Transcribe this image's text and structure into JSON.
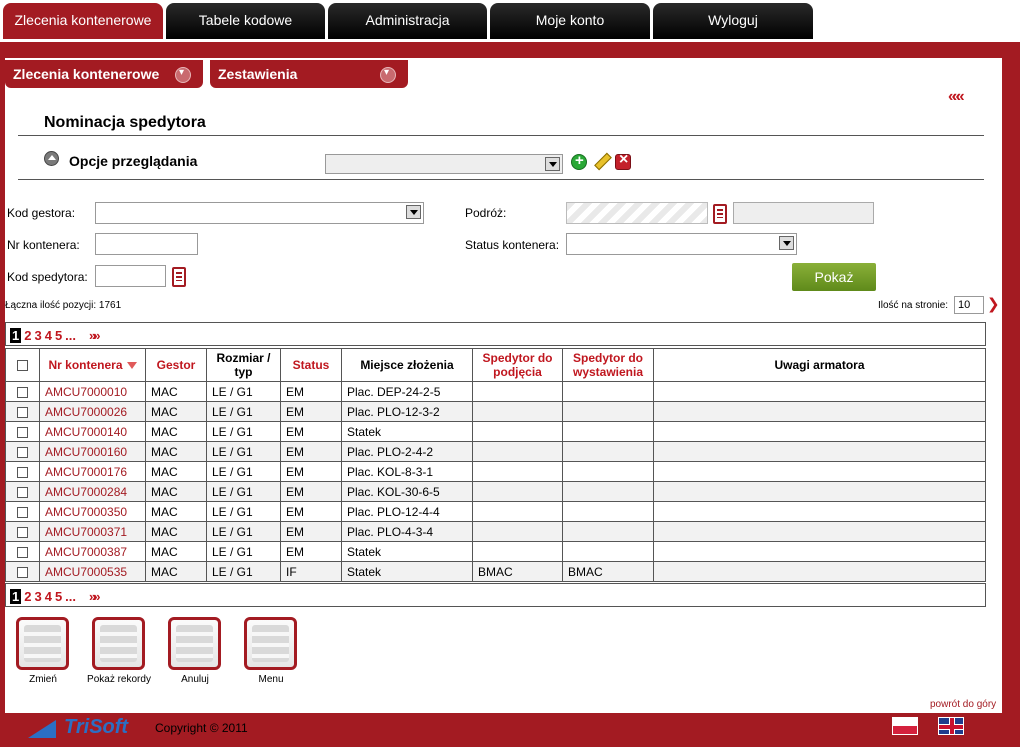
{
  "top_tabs": [
    {
      "label": "Zlecenia kontenerowe",
      "active": true
    },
    {
      "label": "Tabele kodowe",
      "active": false
    },
    {
      "label": "Administracja",
      "active": false
    },
    {
      "label": "Moje konto",
      "active": false
    },
    {
      "label": "Wyloguj",
      "active": false
    }
  ],
  "sub_tabs": [
    {
      "label": "Zlecenia kontenerowe"
    },
    {
      "label": "Zestawienia"
    }
  ],
  "page": {
    "title": "Nominacja spedytora",
    "options_title": "Opcje przeglądania"
  },
  "filters": {
    "kod_gestora_label": "Kod gestora:",
    "nr_kontenera_label": "Nr kontenera:",
    "kod_spedytora_label": "Kod spedytora:",
    "podroz_label": "Podróż:",
    "status_kontenera_label": "Status kontenera:",
    "show_button": "Pokaż"
  },
  "summary": {
    "total_label": "Łączna ilość pozycji: 1761",
    "per_page_label": "Ilość na stronie:",
    "per_page_value": "10"
  },
  "pager": {
    "pages": [
      "1",
      "2",
      "3",
      "4",
      "5",
      "..."
    ],
    "current": "1"
  },
  "table": {
    "headers": [
      {
        "label": "",
        "red": false
      },
      {
        "label": "Nr kontenera",
        "red": true
      },
      {
        "label": "Gestor",
        "red": true
      },
      {
        "label": "Rozmiar / typ",
        "red": false
      },
      {
        "label": "Status",
        "red": true
      },
      {
        "label": "Miejsce złożenia",
        "red": false
      },
      {
        "label": "Spedytor do podjęcia",
        "red": true
      },
      {
        "label": "Spedytor do wystawienia",
        "red": true
      },
      {
        "label": "Uwagi armatora",
        "red": false
      }
    ],
    "rows": [
      [
        "AMCU7000010",
        "MAC",
        "LE / G1",
        "EM",
        "Plac. DEP-24-2-5",
        "",
        "",
        ""
      ],
      [
        "AMCU7000026",
        "MAC",
        "LE / G1",
        "EM",
        "Plac. PLO-12-3-2",
        "",
        "",
        ""
      ],
      [
        "AMCU7000140",
        "MAC",
        "LE / G1",
        "EM",
        "Statek",
        "",
        "",
        ""
      ],
      [
        "AMCU7000160",
        "MAC",
        "LE / G1",
        "EM",
        "Plac. PLO-2-4-2",
        "",
        "",
        ""
      ],
      [
        "AMCU7000176",
        "MAC",
        "LE / G1",
        "EM",
        "Plac. KOL-8-3-1",
        "",
        "",
        ""
      ],
      [
        "AMCU7000284",
        "MAC",
        "LE / G1",
        "EM",
        "Plac. KOL-30-6-5",
        "",
        "",
        ""
      ],
      [
        "AMCU7000350",
        "MAC",
        "LE / G1",
        "EM",
        "Plac. PLO-12-4-4",
        "",
        "",
        ""
      ],
      [
        "AMCU7000371",
        "MAC",
        "LE / G1",
        "EM",
        "Plac. PLO-4-3-4",
        "",
        "",
        ""
      ],
      [
        "AMCU7000387",
        "MAC",
        "LE / G1",
        "EM",
        "Statek",
        "",
        "",
        ""
      ],
      [
        "AMCU7000535",
        "MAC",
        "LE / G1",
        "IF",
        "Statek",
        "BMAC",
        "BMAC",
        ""
      ]
    ]
  },
  "actions": [
    {
      "label": "Zmień",
      "icon": "edit-list-icon"
    },
    {
      "label": "Pokaż rekordy",
      "icon": "show-records-icon"
    },
    {
      "label": "Anuluj",
      "icon": "cancel-list-icon"
    },
    {
      "label": "Menu",
      "icon": "menu-icon"
    }
  ],
  "footer": {
    "back_to_top": "powrót do góry",
    "logo_text": "TriSoft",
    "copyright": "Copyright © 2011"
  },
  "colors": {
    "brand_red": "#a31b22",
    "link_red": "#c0171f",
    "show_green": "#6f9a24"
  }
}
